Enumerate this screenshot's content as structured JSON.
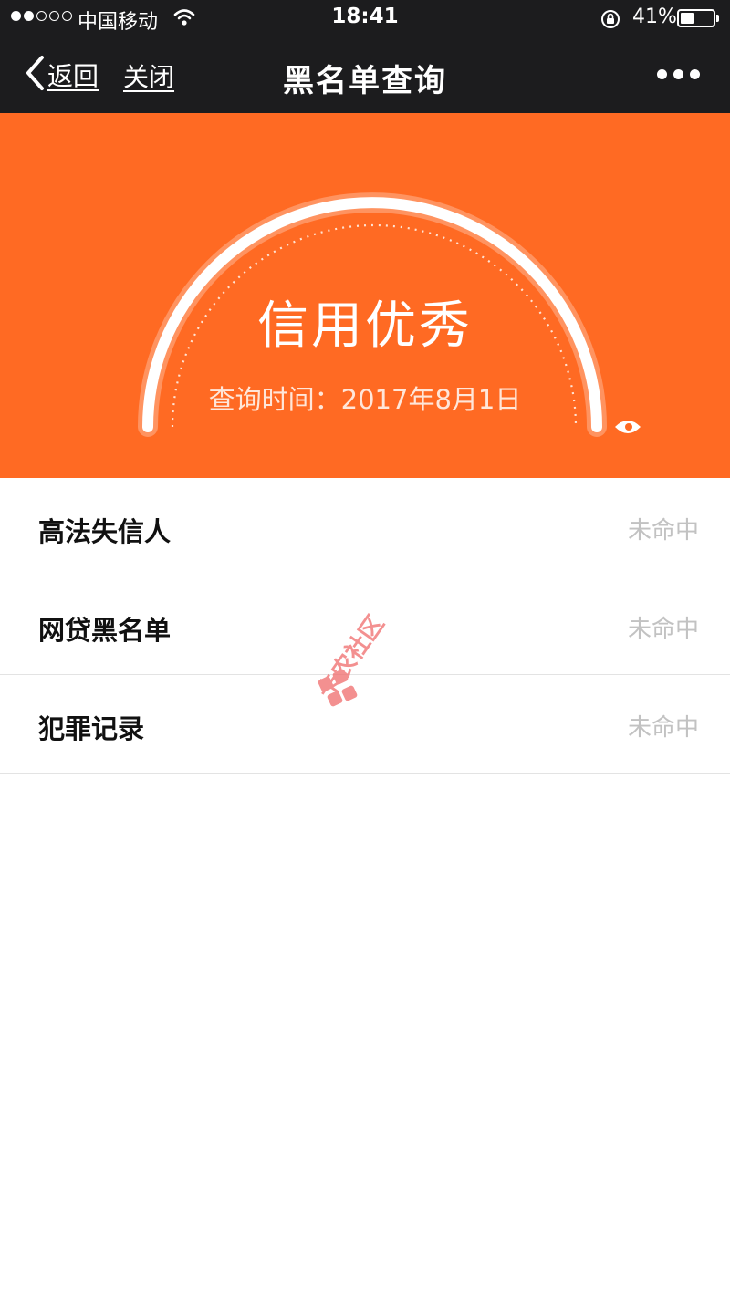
{
  "status_bar": {
    "carrier": "中国移动",
    "time": "18:41",
    "battery_percent": "41%",
    "battery_level": 0.41,
    "signal_bars_filled": 2,
    "signal_bars_total": 5,
    "icons": [
      "wifi-icon",
      "rotation-lock-icon",
      "battery-icon"
    ]
  },
  "nav": {
    "back_label": "返回",
    "close_label": "关闭",
    "title": "黑名单查询",
    "more_icon": "more-dots-icon"
  },
  "hero": {
    "status": "信用优秀",
    "query_time": "查询时间：2017年8月1日",
    "background_color": "#ff6a23",
    "gauge_level": 1.0
  },
  "results": [
    {
      "label": "高法失信人",
      "value": "未命中"
    },
    {
      "label": "网贷黑名单",
      "value": "未命中"
    },
    {
      "label": "犯罪记录",
      "value": "未命中"
    }
  ],
  "watermark": {
    "text": "卡农社区",
    "color": "#f06b6b"
  }
}
